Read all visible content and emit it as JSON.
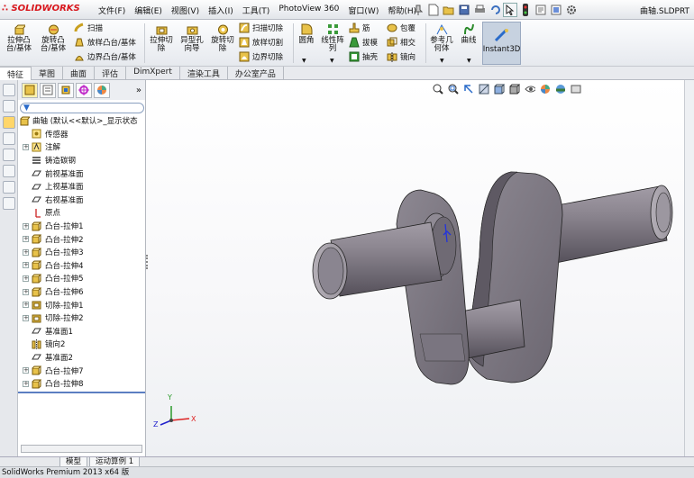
{
  "app": {
    "logo_text": "SOLIDWORKS",
    "document_title": "曲轴.SLDPRT",
    "status_text": "SolidWorks Premium 2013 x64 版"
  },
  "menu": [
    "文件(F)",
    "编辑(E)",
    "视图(V)",
    "插入(I)",
    "工具(T)",
    "PhotoView 360",
    "窗口(W)",
    "帮助(H)"
  ],
  "ribbon": {
    "extrude_boss": "拉伸凸\n台/基体",
    "revolve_boss": "旋转凸\n台/基体",
    "sweep": "扫描",
    "loft_boss": "放样凸台/基体",
    "boundary_boss": "边界凸台/基体",
    "extrude_cut": "拉伸切\n除",
    "hole_wizard": "异型孔\n向导",
    "revolve_cut": "旋转切\n除",
    "swept_cut": "扫描切除",
    "lofted_cut": "放样切割",
    "boundary_cut": "边界切除",
    "fillet": "圆角",
    "linear_pattern": "线性阵\n列",
    "rib": "筋",
    "draft": "拔模",
    "shell": "抽壳",
    "wrap": "包覆",
    "intersect": "相交",
    "mirror": "镜向",
    "ref_geometry": "参考几\n何体",
    "curves": "曲线",
    "instant3d": "Instant3D"
  },
  "tabs": [
    "特征",
    "草图",
    "曲面",
    "评估",
    "DimXpert",
    "渲染工具",
    "办公室产品"
  ],
  "tree": {
    "root": "曲轴  (默认<<默认>_显示状态",
    "items": [
      {
        "label": "传感器",
        "icon": "sensor-icon",
        "expandable": false
      },
      {
        "label": "注解",
        "icon": "annotation-icon",
        "expandable": true
      },
      {
        "label": "铸造碳钢",
        "icon": "material-icon",
        "expandable": false
      },
      {
        "label": "前视基准面",
        "icon": "plane-icon",
        "expandable": false
      },
      {
        "label": "上视基准面",
        "icon": "plane-icon",
        "expandable": false
      },
      {
        "label": "右视基准面",
        "icon": "plane-icon",
        "expandable": false
      },
      {
        "label": "原点",
        "icon": "origin-icon",
        "expandable": false
      },
      {
        "label": "凸台-拉伸1",
        "icon": "extrude-icon",
        "expandable": true
      },
      {
        "label": "凸台-拉伸2",
        "icon": "extrude-icon",
        "expandable": true
      },
      {
        "label": "凸台-拉伸3",
        "icon": "extrude-icon",
        "expandable": true
      },
      {
        "label": "凸台-拉伸4",
        "icon": "extrude-icon",
        "expandable": true
      },
      {
        "label": "凸台-拉伸5",
        "icon": "extrude-icon",
        "expandable": true
      },
      {
        "label": "凸台-拉伸6",
        "icon": "extrude-icon",
        "expandable": true
      },
      {
        "label": "切除-拉伸1",
        "icon": "cut-icon",
        "expandable": true
      },
      {
        "label": "切除-拉伸2",
        "icon": "cut-icon",
        "expandable": true
      },
      {
        "label": "基准面1",
        "icon": "plane-icon",
        "expandable": false
      },
      {
        "label": "镜向2",
        "icon": "mirror-icon",
        "expandable": false
      },
      {
        "label": "基准面2",
        "icon": "plane-icon",
        "expandable": false
      },
      {
        "label": "凸台-拉伸7",
        "icon": "extrude-icon",
        "expandable": true
      },
      {
        "label": "凸台-拉伸8",
        "icon": "extrude-icon",
        "expandable": true
      }
    ]
  },
  "bottom_tabs": [
    "模型",
    "运动算例 1"
  ],
  "triad": {
    "x": "X",
    "y": "Y",
    "z": "Z"
  },
  "colors": {
    "accent": "#d8161c",
    "selection_blue": "#5b7ec2",
    "model_gray": "#8a8590"
  }
}
